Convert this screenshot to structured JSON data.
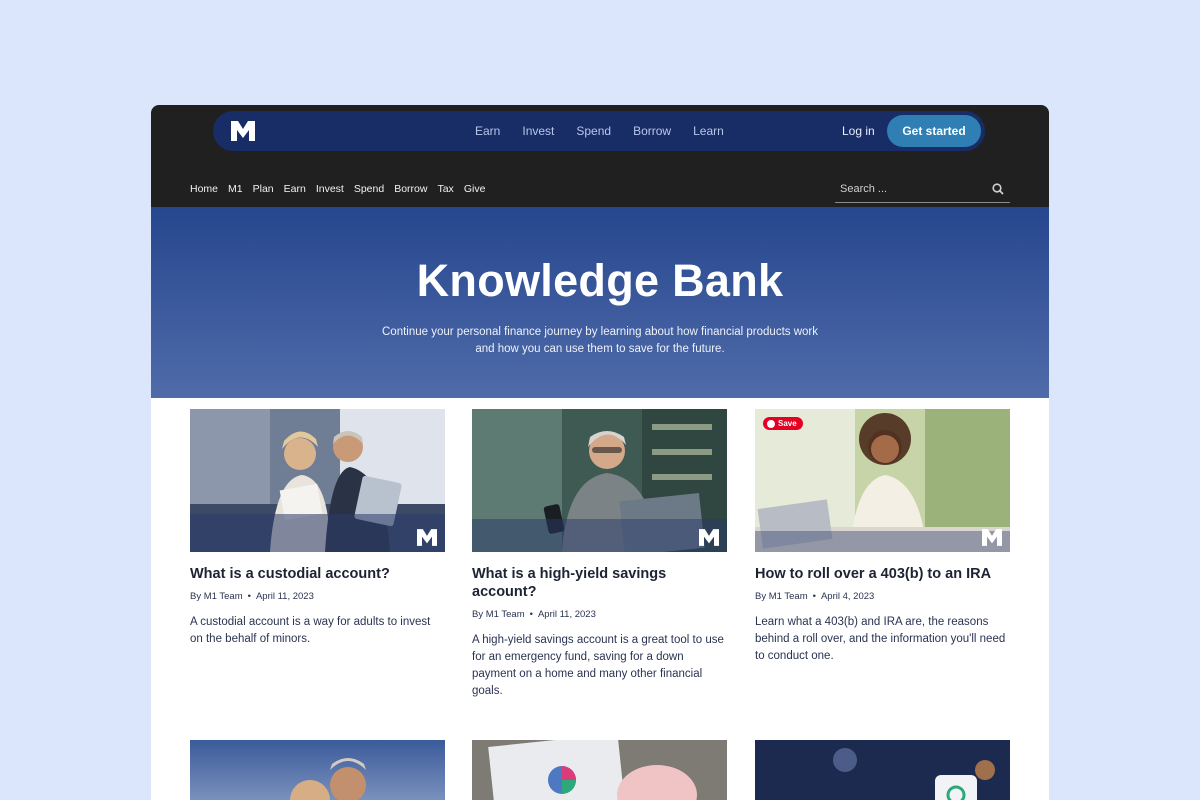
{
  "header": {
    "logo": "M1",
    "nav": [
      "Earn",
      "Invest",
      "Spend",
      "Borrow",
      "Learn"
    ],
    "login": "Log in",
    "cta": "Get started"
  },
  "subnav": [
    "Home",
    "M1",
    "Plan",
    "Earn",
    "Invest",
    "Spend",
    "Borrow",
    "Tax",
    "Give"
  ],
  "search": {
    "placeholder": "Search ..."
  },
  "hero": {
    "title": "Knowledge Bank",
    "subtitle": "Continue your personal finance journey by learning about how financial products work and how you can use them to save for the future."
  },
  "articles": [
    {
      "title": "What is a custodial account?",
      "author": "By M1 Team",
      "date": "April 11, 2023",
      "excerpt": "A custodial account is a way for adults to invest on the behalf of minors."
    },
    {
      "title": "What is a high-yield savings account?",
      "author": "By M1 Team",
      "date": "April 11, 2023",
      "excerpt": "A high-yield savings account is a great tool to use for an emergency fund, saving for a down payment on a home and many other financial goals."
    },
    {
      "title": "How to roll over a 403(b) to an IRA",
      "author": "By M1 Team",
      "date": "April 4, 2023",
      "excerpt": "Learn what a 403(b) and IRA are, the reasons behind a roll over, and the information you'll need to conduct one.",
      "badge": "Save"
    }
  ],
  "colors": {
    "page_bg": "#dbe5fb",
    "topbar": "#202020",
    "nav_pill": "#182d66",
    "cta": "#2f7fb5",
    "hero_top": "#26468e",
    "hero_bottom": "#4f6ba9",
    "pin_badge": "#e60023"
  }
}
